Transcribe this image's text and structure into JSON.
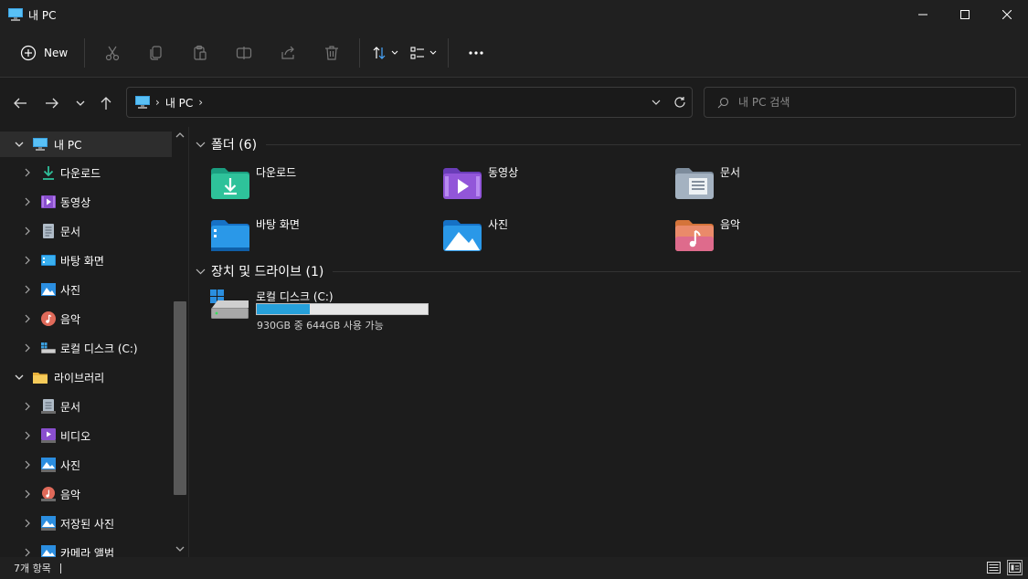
{
  "window": {
    "title": "내 PC"
  },
  "commandbar": {
    "new_label": "New"
  },
  "address": {
    "crumb": "내 PC"
  },
  "search": {
    "placeholder": "내 PC 검색"
  },
  "sidebar": {
    "items": [
      {
        "label": "내 PC",
        "icon": "pc-icon"
      },
      {
        "label": "다운로드",
        "icon": "downloads-icon"
      },
      {
        "label": "동영상",
        "icon": "videos-icon"
      },
      {
        "label": "문서",
        "icon": "documents-icon"
      },
      {
        "label": "바탕 화면",
        "icon": "desktop-icon"
      },
      {
        "label": "사진",
        "icon": "pictures-icon"
      },
      {
        "label": "음악",
        "icon": "music-icon"
      },
      {
        "label": "로컬 디스크 (C:)",
        "icon": "drive-icon"
      },
      {
        "label": "라이브러리",
        "icon": "libraries-icon"
      },
      {
        "label": "문서",
        "icon": "documents-icon"
      },
      {
        "label": "비디오",
        "icon": "videos-icon"
      },
      {
        "label": "사진",
        "icon": "pictures-icon"
      },
      {
        "label": "음악",
        "icon": "music-icon"
      },
      {
        "label": "저장된 사진",
        "icon": "pictures-icon"
      },
      {
        "label": "카메라 앨범",
        "icon": "pictures-icon"
      }
    ]
  },
  "content": {
    "folders_header": "폴더 (6)",
    "folders": [
      {
        "label": "다운로드",
        "icon": "downloads-folder-icon"
      },
      {
        "label": "동영상",
        "icon": "videos-folder-icon"
      },
      {
        "label": "문서",
        "icon": "documents-folder-icon"
      },
      {
        "label": "바탕 화면",
        "icon": "desktop-folder-icon"
      },
      {
        "label": "사진",
        "icon": "pictures-folder-icon"
      },
      {
        "label": "음악",
        "icon": "music-folder-icon"
      }
    ],
    "devices_header": "장치 및 드라이브 (1)",
    "drive": {
      "label": "로컬 디스크 (C:)",
      "usage_text": "930GB 중 644GB 사용 가능",
      "used_fraction": 0.31
    }
  },
  "status": {
    "item_count": "7개 항목"
  },
  "colors": {
    "accent": "#26a0da",
    "background": "#1c1c1c",
    "chrome": "#202020"
  }
}
